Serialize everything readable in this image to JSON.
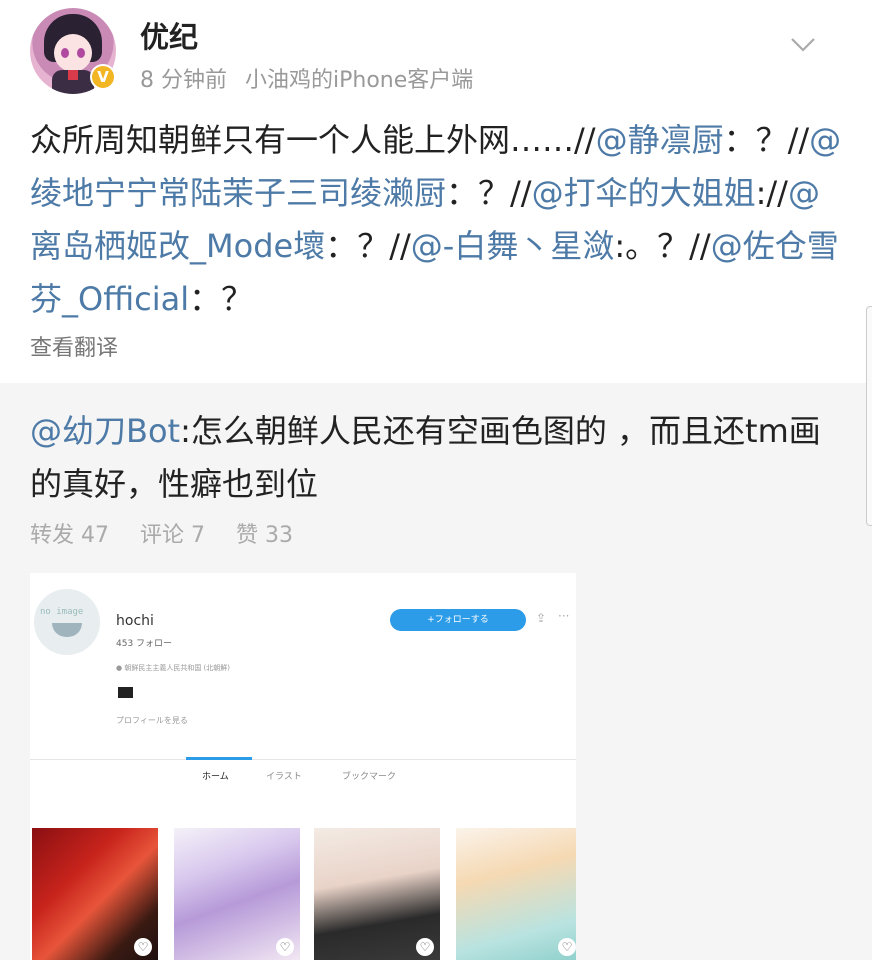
{
  "post": {
    "username": "优纪",
    "time": "8 分钟前",
    "source": "小油鸡的iPhone客户端",
    "verified_badge": "V",
    "text_parts": [
      {
        "t": "众所周知朝鲜只有一个人能上外网……//",
        "m": false
      },
      {
        "t": "@静凛厨",
        "m": true
      },
      {
        "t": "：？//",
        "m": false
      },
      {
        "t": "@绫地宁宁常陆茉子三司绫濑厨",
        "m": true
      },
      {
        "t": "：？//",
        "m": false
      },
      {
        "t": "@打伞的大姐姐",
        "m": true
      },
      {
        "t": "://",
        "m": false
      },
      {
        "t": "@离岛栖姬改_Mode壞",
        "m": true
      },
      {
        "t": "：？//",
        "m": false
      },
      {
        "t": "@-白舞丶星潋",
        "m": true
      },
      {
        "t": ":。？//",
        "m": false
      },
      {
        "t": "@佐仓雪芬_Official",
        "m": true
      },
      {
        "t": "：？",
        "m": false
      }
    ],
    "translate_label": "查看翻译"
  },
  "repost": {
    "author": "@幼刀Bot",
    "text": ":怎么朝鲜人民还有空画色图的 ，而且还tm画的真好，性癖也到位",
    "stats": {
      "repost": "转发 47",
      "comment": "评论 7",
      "like": "赞 33"
    }
  },
  "screenshot": {
    "avatar_logo": "no image",
    "name": "hochi",
    "follows": "453 フォロー",
    "location": "● 朝鲜民主主義人民共和国 (北朝鮮)",
    "profile_link": "プロフィールを見る",
    "follow_button": "+フォローする",
    "share_icon": "⇪",
    "more_icon": "···",
    "tabs": [
      "ホーム",
      "イラスト",
      "ブックマーク"
    ],
    "thumbnails": [
      {
        "heart": "♡"
      },
      {
        "heart": "♡"
      },
      {
        "heart": "♡"
      },
      {
        "heart": "♡"
      }
    ]
  }
}
